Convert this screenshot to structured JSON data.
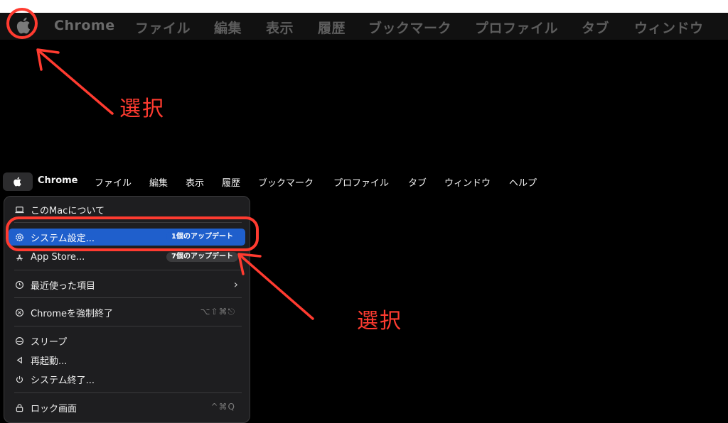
{
  "menubar": {
    "app_name": "Chrome",
    "items": [
      "ファイル",
      "編集",
      "表示",
      "履歴",
      "ブックマーク",
      "プロファイル",
      "タブ",
      "ウィンドウ",
      "ヘルプ"
    ]
  },
  "apple_menu": {
    "about": "このMacについて",
    "system_settings": "システム設定...",
    "system_settings_badge": "1個のアップデート",
    "app_store": "App Store...",
    "app_store_badge": "7個のアップデート",
    "recent_items": "最近使った項目",
    "force_quit": "Chromeを強制終了",
    "force_quit_shortcut": "⌥⇧⌘⎋",
    "sleep": "スリープ",
    "restart": "再起動...",
    "shutdown": "システム終了...",
    "lock_screen": "ロック画面",
    "lock_screen_shortcut": "^⌘Q"
  },
  "annotations": {
    "label_top": "選択",
    "label_bottom": "選択",
    "color": "#ff3b30"
  },
  "colors": {
    "selection": "#1f5fcc",
    "menu_bg": "#1e1e20"
  }
}
